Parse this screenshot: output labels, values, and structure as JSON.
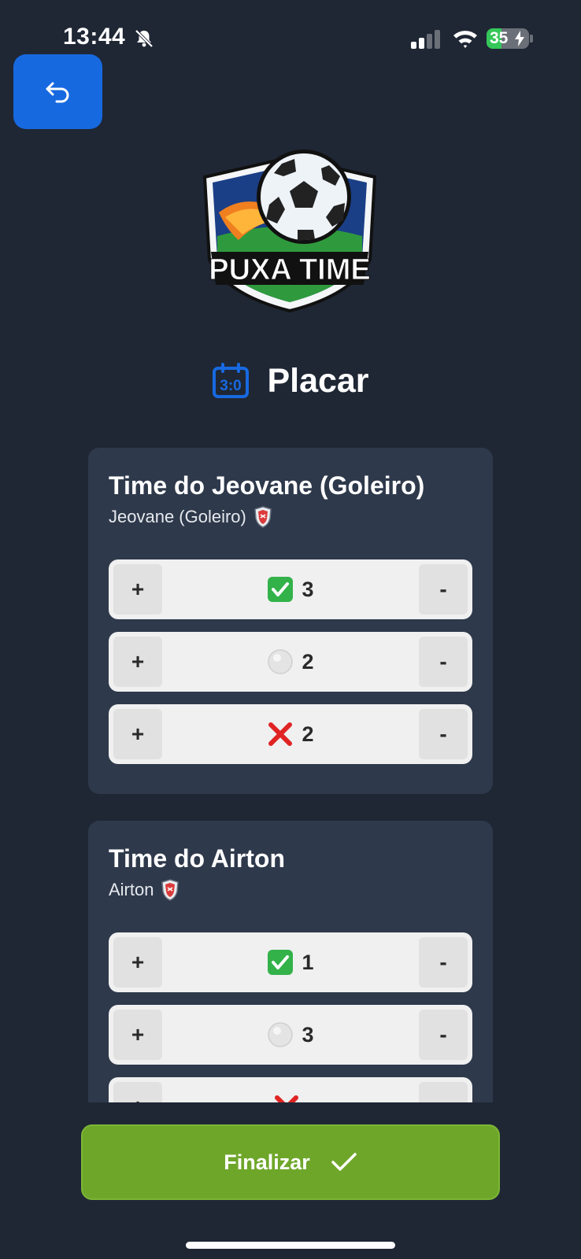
{
  "status_bar": {
    "time": "13:44",
    "battery": "35",
    "battery_level": 0.35
  },
  "app": {
    "title": "Placar",
    "logo_text": "PUXA TIME"
  },
  "teams": [
    {
      "name": "Time do Jeovane (Goleiro)",
      "players": "Jeovane (Goleiro)",
      "counters": [
        {
          "icon": "check-mark-icon",
          "value": "3",
          "plus": "+",
          "minus": "-"
        },
        {
          "icon": "white-circle-icon",
          "value": "2",
          "plus": "+",
          "minus": "-"
        },
        {
          "icon": "cross-mark-icon",
          "value": "2",
          "plus": "+",
          "minus": "-"
        }
      ]
    },
    {
      "name": "Time do Airton",
      "players": "Airton",
      "counters": [
        {
          "icon": "check-mark-icon",
          "value": "1",
          "plus": "+",
          "minus": "-"
        },
        {
          "icon": "white-circle-icon",
          "value": "3",
          "plus": "+",
          "minus": "-"
        },
        {
          "icon": "cross-mark-icon",
          "value": "",
          "plus": "+",
          "minus": "-"
        }
      ]
    }
  ],
  "actions": {
    "finalize": "Finalizar"
  },
  "colors": {
    "background": "#1f2735",
    "card": "#2e394b",
    "accent_blue": "#1769e0",
    "finalize_green": "#6ea62a"
  }
}
